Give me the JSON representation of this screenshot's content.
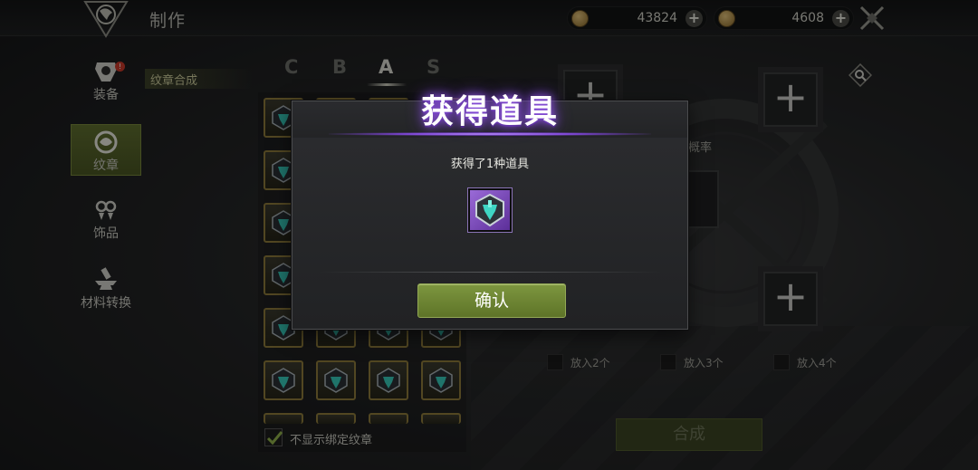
{
  "header": {
    "title": "制作",
    "currency1": {
      "value": "43824",
      "icon": "coin-icon"
    },
    "currency2": {
      "value": "4608",
      "icon": "coin-icon"
    },
    "plus": "+"
  },
  "sidebar": {
    "items": [
      {
        "label": "装备",
        "icon": "armor-icon",
        "badge": "!"
      },
      {
        "label": "纹章",
        "icon": "emblem-icon"
      },
      {
        "label": "饰品",
        "icon": "accessory-icon"
      },
      {
        "label": "材料转换",
        "icon": "anvil-icon"
      }
    ],
    "active_index": 1
  },
  "subnav": {
    "label": "纹章合成"
  },
  "tabs": [
    "C",
    "B",
    "A",
    "S"
  ],
  "active_tab": "A",
  "grid": {
    "checkbox_label": "不显示绑定纹章",
    "checked": true
  },
  "right": {
    "probability_label": "概率",
    "put_options": [
      "放入2个",
      "放入3个",
      "放入4个"
    ],
    "synth_button": "合成",
    "plus": "+"
  },
  "modal": {
    "title": "获得道具",
    "subtitle": "获得了1种道具",
    "confirm": "确认",
    "item_icon": "emblem-icon"
  },
  "colors": {
    "accent_green": "#7d963f",
    "title_glow": "#9a5cf0",
    "slot_border": "#8d7b3c"
  }
}
